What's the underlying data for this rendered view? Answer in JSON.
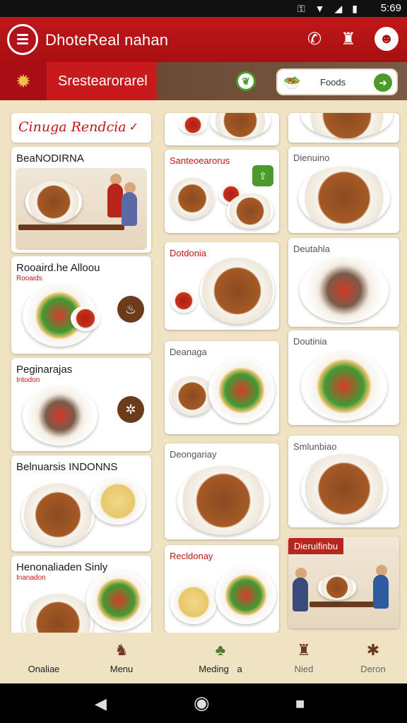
{
  "status_bar": {
    "time": "5:69",
    "icons": [
      "key-icon",
      "wifi-icon",
      "signal-icon",
      "battery-icon"
    ]
  },
  "app_bar": {
    "title": "DhoteReal nahan"
  },
  "sub_bar": {
    "title": "Srestearorarel",
    "foods_label": "Foods"
  },
  "heading": {
    "title": "Cinuga Rendcia"
  },
  "left_cards": [
    {
      "title": "BeaNODIRNA",
      "subtitle": ""
    },
    {
      "title": "Rooaird.he Alloou",
      "subtitle": "Rooaids"
    },
    {
      "title": "Peginarajas",
      "subtitle": "Intodon"
    },
    {
      "title": "Belnuarsis INDONNS",
      "subtitle": ""
    },
    {
      "title": "Henonaliaden Sinly",
      "subtitle": "Inanadon"
    }
  ],
  "mid_cards": [
    {
      "title": "Santeoearorus"
    },
    {
      "title": "Dotdonia"
    },
    {
      "title": "Deanaga"
    },
    {
      "title": "Deongariay"
    },
    {
      "title": "Recldonay"
    }
  ],
  "right_cards": [
    {
      "title": "Dienuino"
    },
    {
      "title": "Deutahla"
    },
    {
      "title": "Doutinia"
    },
    {
      "title": "Smlunbiao"
    },
    {
      "title": "Dieruifinbu"
    }
  ],
  "bottom_nav": [
    {
      "label": "Onaliae",
      "icon": "home-icon"
    },
    {
      "label": "Menu",
      "icon": "menu-book-icon"
    },
    {
      "label": "Meding",
      "badge": "a",
      "icon": "dish-icon"
    },
    {
      "label": "Nied",
      "icon": "cake-icon"
    },
    {
      "label": "Deron",
      "icon": "star-icon"
    }
  ],
  "colors": {
    "primary_red": "#c0171a",
    "accent_green": "#4b9b2a",
    "background": "#efe3c4"
  }
}
